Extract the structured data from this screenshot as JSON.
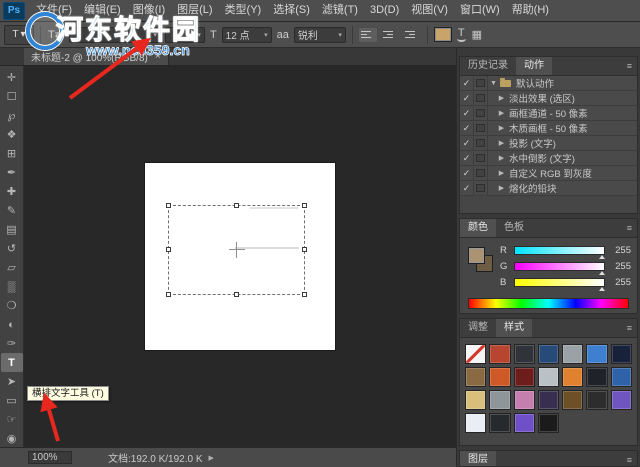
{
  "watermark": {
    "site_name": "河东软件园",
    "site_url": "www.pc0359.cn"
  },
  "menu_bar": {
    "logo": "Ps",
    "items": [
      "文件(F)",
      "编辑(E)",
      "图像(I)",
      "图层(L)",
      "类型(Y)",
      "选择(S)",
      "滤镜(T)",
      "3D(D)",
      "视图(V)",
      "窗口(W)",
      "帮助(H)"
    ]
  },
  "options_bar": {
    "tool_preset_glyph": "T",
    "caret": "▾",
    "orientation_glyph": "T⇄",
    "font_family_value": "",
    "font_style_value": "",
    "size_glyph": "T",
    "font_size_value": "12 点",
    "aa_glyph": "aa",
    "anti_alias_value": "锐利",
    "text_color": "#c9a46a",
    "warp_glyph": "T",
    "panel_toggle_glyph": "▦"
  },
  "document_tab": {
    "title": "未标题-2 @ 100%(RGB/8)",
    "close": "×"
  },
  "toolbar": {
    "tools": [
      {
        "name": "move-tool",
        "glyph": "✛"
      },
      {
        "name": "marquee-tool",
        "glyph": "☐"
      },
      {
        "name": "lasso-tool",
        "glyph": "℘"
      },
      {
        "name": "quick-selection-tool",
        "glyph": "❖"
      },
      {
        "name": "crop-tool",
        "glyph": "⊞"
      },
      {
        "name": "eyedropper-tool",
        "glyph": "✒"
      },
      {
        "name": "healing-brush-tool",
        "glyph": "✚"
      },
      {
        "name": "brush-tool",
        "glyph": "✎"
      },
      {
        "name": "clone-stamp-tool",
        "glyph": "▤"
      },
      {
        "name": "history-brush-tool",
        "glyph": "↺"
      },
      {
        "name": "eraser-tool",
        "glyph": "▱"
      },
      {
        "name": "gradient-tool",
        "glyph": "▒"
      },
      {
        "name": "blur-tool",
        "glyph": "❍"
      },
      {
        "name": "dodge-tool",
        "glyph": "◐"
      },
      {
        "name": "pen-tool",
        "glyph": "✑"
      },
      {
        "name": "type-tool",
        "glyph": "T",
        "selected": true
      },
      {
        "name": "path-selection-tool",
        "glyph": "➤"
      },
      {
        "name": "rectangle-tool",
        "glyph": "▭"
      },
      {
        "name": "hand-tool",
        "glyph": "☞"
      },
      {
        "name": "zoom-tool",
        "glyph": "◉"
      }
    ]
  },
  "tooltip": {
    "text": "横排文字工具 (T)"
  },
  "status_bar": {
    "zoom": "100%",
    "doc_info": "文档:192.0 K/192.0 K",
    "menu_arrow": "▶"
  },
  "panels": {
    "menu_icon": "≡",
    "history_actions": {
      "tabs": [
        "历史记录",
        "动作"
      ],
      "check_glyph": "✓",
      "rows": [
        {
          "type": "folder",
          "expanded": true,
          "label": "默认动作"
        },
        {
          "type": "action",
          "label": "淡出效果 (选区)"
        },
        {
          "type": "action",
          "label": "画框通道 - 50 像素"
        },
        {
          "type": "action",
          "label": "木质画框 - 50 像素"
        },
        {
          "type": "action",
          "label": "投影 (文字)"
        },
        {
          "type": "action",
          "label": "水中倒影 (文字)"
        },
        {
          "type": "action",
          "label": "自定义 RGB 到灰度"
        },
        {
          "type": "action",
          "label": "熔化的铅块"
        }
      ]
    },
    "color": {
      "tabs": [
        "颜色",
        "色板"
      ],
      "foreground": "#ab9372",
      "background": "#6e5d45",
      "channels": [
        {
          "label": "R",
          "value": "255"
        },
        {
          "label": "G",
          "value": "255"
        },
        {
          "label": "B",
          "value": "255"
        }
      ]
    },
    "styles": {
      "tabs": [
        "调整",
        "样式"
      ],
      "swatches": [
        [
          "none",
          "#b8452f",
          "#30343a",
          "#274a78",
          "#9aa2a8",
          "#3f7fd0",
          "#17213a"
        ],
        [
          "#8a6a42",
          "#cf5a28",
          "#6e1d1d",
          "#b9c0c6",
          "#e0812f",
          "#1f2329",
          "#2f62a8"
        ],
        [
          "#d8c07c",
          "#8e969c",
          "#c47fae",
          "#382f50",
          "#6d4f28",
          "#2d2d2d",
          "#6f55c0"
        ],
        [
          "#e9eef4",
          "#26292d",
          "#6f50c8",
          "#1b1b1b"
        ]
      ]
    },
    "layers": {
      "tab": "图层"
    }
  },
  "annotations": {
    "arrow_color": "#e8281e"
  }
}
